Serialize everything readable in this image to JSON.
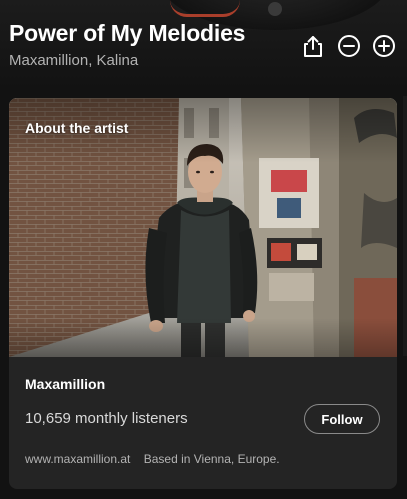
{
  "track": {
    "title": "Power of My Melodies",
    "artists": "Maxamillion, Kalina"
  },
  "actions": {
    "share_icon": "share-icon",
    "remove_icon": "minus-circle-icon",
    "add_icon": "plus-circle-icon"
  },
  "about_card": {
    "heading": "About the artist",
    "artist_name": "Maxamillion",
    "monthly_listeners": "10,659 monthly listeners",
    "follow_label": "Follow",
    "website": "www.maxamillion.at",
    "location": "Based in Vienna, Europe."
  },
  "colors": {
    "background": "#121212",
    "card": "#242424",
    "secondary_text": "#b3b3b3",
    "accent_art": "#c4462f"
  }
}
